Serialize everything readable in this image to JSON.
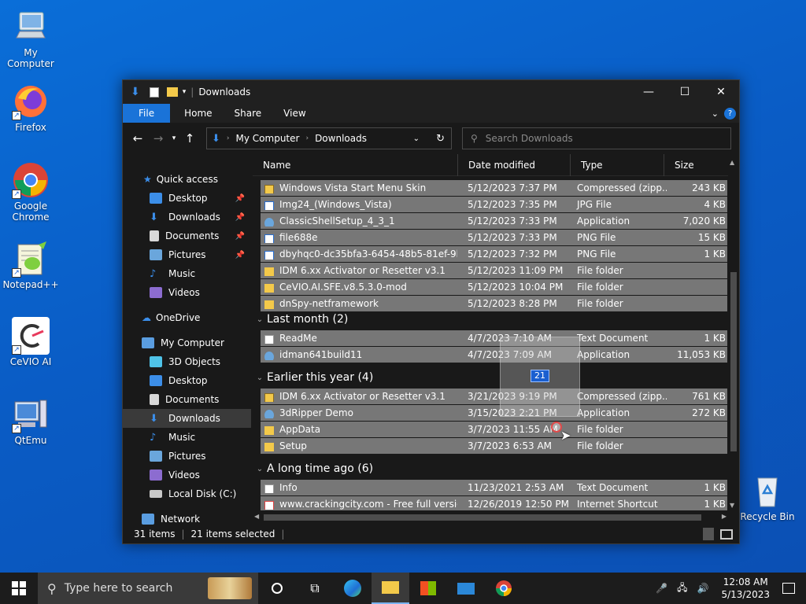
{
  "desktop": {
    "icons": [
      {
        "label": "My Computer"
      },
      {
        "label": "Firefox"
      },
      {
        "label": "Google Chrome"
      },
      {
        "label": "Notepad++"
      },
      {
        "label": "CeVIO AI"
      },
      {
        "label": "QtEmu"
      },
      {
        "label": "Recycle Bin"
      }
    ]
  },
  "window": {
    "title": "Downloads",
    "ribbon_tabs": [
      "File",
      "Home",
      "Share",
      "View"
    ],
    "address": {
      "root": "My Computer",
      "current": "Downloads"
    },
    "search_placeholder": "Search Downloads",
    "columns": [
      "Name",
      "Date modified",
      "Type",
      "Size"
    ],
    "nav": {
      "quick_access": "Quick access",
      "quick_items": [
        "Desktop",
        "Downloads",
        "Documents",
        "Pictures",
        "Music",
        "Videos"
      ],
      "onedrive": "OneDrive",
      "my_computer": "My Computer",
      "pc_items": [
        "3D Objects",
        "Desktop",
        "Documents",
        "Downloads",
        "Music",
        "Pictures",
        "Videos",
        "Local Disk (C:)"
      ],
      "network": "Network"
    },
    "groups": {
      "last_month": "Last month (2)",
      "earlier_this_year": "Earlier this year (4)",
      "long_time_ago": "A long time ago (6)"
    },
    "files_top": [
      {
        "name": "Windows Vista Start Menu Skin",
        "date": "5/12/2023 7:37 PM",
        "type": "Compressed (zipp...",
        "size": "243 KB",
        "icon": "zip"
      },
      {
        "name": "Img24_(Windows_Vista)",
        "date": "5/12/2023 7:35 PM",
        "type": "JPG File",
        "size": "4 KB",
        "icon": "img"
      },
      {
        "name": "ClassicShellSetup_4_3_1",
        "date": "5/12/2023 7:33 PM",
        "type": "Application",
        "size": "7,020 KB",
        "icon": "app"
      },
      {
        "name": "file688e",
        "date": "5/12/2023 7:33 PM",
        "type": "PNG File",
        "size": "15 KB",
        "icon": "img"
      },
      {
        "name": "dbyhqc0-dc35bfa3-6454-48b5-81ef-9beb...",
        "date": "5/12/2023 7:32 PM",
        "type": "PNG File",
        "size": "1 KB",
        "icon": "img"
      },
      {
        "name": "IDM 6.xx Activator or Resetter v3.1",
        "date": "5/12/2023 11:09 PM",
        "type": "File folder",
        "size": "",
        "icon": "folder"
      },
      {
        "name": "CeVIO.AI.SFE.v8.5.3.0-mod",
        "date": "5/12/2023 10:04 PM",
        "type": "File folder",
        "size": "",
        "icon": "folder"
      },
      {
        "name": "dnSpy-netframework",
        "date": "5/12/2023 8:28 PM",
        "type": "File folder",
        "size": "",
        "icon": "folder"
      }
    ],
    "files_last_month": [
      {
        "name": "ReadMe",
        "date": "4/7/2023 7:10 AM",
        "type": "Text Document",
        "size": "1 KB",
        "icon": "txt"
      },
      {
        "name": "idman641build11",
        "date": "4/7/2023 7:09 AM",
        "type": "Application",
        "size": "11,053 KB",
        "icon": "app"
      }
    ],
    "files_earlier": [
      {
        "name": "IDM 6.xx Activator or Resetter v3.1",
        "date": "3/21/2023 9:19 PM",
        "type": "Compressed (zipp...",
        "size": "761 KB",
        "icon": "zip"
      },
      {
        "name": "3dRipper Demo",
        "date": "3/15/2023 2:21 PM",
        "type": "Application",
        "size": "272 KB",
        "icon": "app"
      },
      {
        "name": "AppData",
        "date": "3/7/2023 11:55 AM",
        "type": "File folder",
        "size": "",
        "icon": "folder"
      },
      {
        "name": "Setup",
        "date": "3/7/2023 6:53 AM",
        "type": "File folder",
        "size": "",
        "icon": "folder"
      }
    ],
    "files_old": [
      {
        "name": "Info",
        "date": "11/23/2021 2:53 AM",
        "type": "Text Document",
        "size": "1 KB",
        "icon": "txt"
      },
      {
        "name": "www.crackingcity.com - Free full version...",
        "date": "12/26/2019 12:50 PM",
        "type": "Internet Shortcut",
        "size": "1 KB",
        "icon": "url"
      }
    ],
    "drag_count": "21",
    "status": {
      "items": "31 items",
      "selected": "21 items selected"
    }
  },
  "taskbar": {
    "search_placeholder": "Type here to search",
    "time": "12:08 AM",
    "date": "5/13/2023"
  },
  "colors": {
    "accent": "#1a73d8",
    "selection": "#777777",
    "window_bg": "#191919"
  }
}
